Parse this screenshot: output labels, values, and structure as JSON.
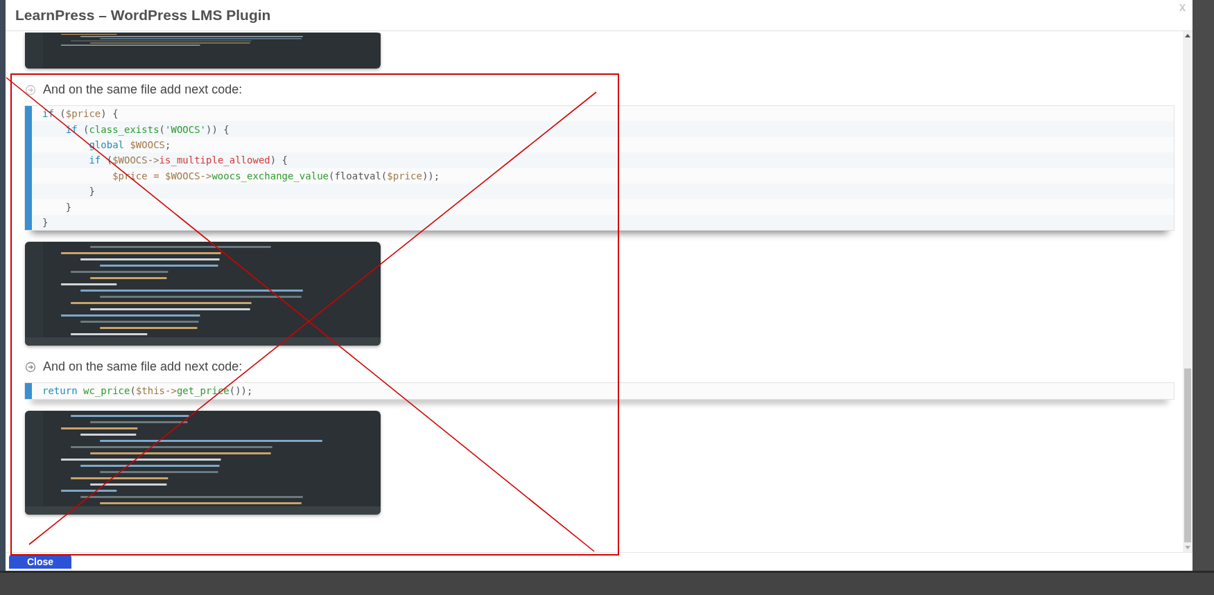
{
  "modal": {
    "title": "LearnPress – WordPress LMS Plugin",
    "close_glyph": "x"
  },
  "sections": [
    {
      "kind": "picture"
    },
    {
      "kind": "step",
      "text": "And on the same file add next code:",
      "faded": true
    },
    {
      "kind": "code",
      "lines": [
        [
          {
            "t": "if",
            "kind": "kw"
          },
          {
            "t": " (",
            "kind": "plain"
          },
          {
            "t": "$price",
            "kind": "var"
          },
          {
            "t": ") {",
            "kind": "plain"
          }
        ],
        [
          {
            "t": "    if",
            "kind": "kw"
          },
          {
            "t": " (",
            "kind": "plain"
          },
          {
            "t": "class_exists",
            "kind": "fn"
          },
          {
            "t": "(",
            "kind": "plain"
          },
          {
            "t": "'WOOCS'",
            "kind": "str"
          },
          {
            "t": ")) {",
            "kind": "plain"
          }
        ],
        [
          {
            "t": "        global",
            "kind": "kw"
          },
          {
            "t": " $WOOCS",
            "kind": "var"
          },
          {
            "t": ";",
            "kind": "plain"
          }
        ],
        [
          {
            "t": "        if",
            "kind": "kw"
          },
          {
            "t": " (",
            "kind": "plain"
          },
          {
            "t": "$WOOCS->",
            "kind": "var"
          },
          {
            "t": "is_multiple_allowed",
            "kind": "prop"
          },
          {
            "t": ") {",
            "kind": "plain"
          }
        ],
        [
          {
            "t": "            $price = $WOOCS->",
            "kind": "var"
          },
          {
            "t": "woocs_exchange_value",
            "kind": "fn"
          },
          {
            "t": "(floatval(",
            "kind": "plain"
          },
          {
            "t": "$price",
            "kind": "var"
          },
          {
            "t": "));",
            "kind": "plain"
          }
        ],
        [
          {
            "t": "        }",
            "kind": "plain"
          }
        ],
        [
          {
            "t": "    }",
            "kind": "plain"
          }
        ],
        [
          {
            "t": "}",
            "kind": "plain"
          }
        ]
      ]
    },
    {
      "kind": "picture"
    },
    {
      "kind": "step",
      "text": "And on the same file add next code:",
      "faded": false
    },
    {
      "kind": "code",
      "lines": [
        [
          {
            "t": "return",
            "kind": "kw"
          },
          {
            "t": " wc_price",
            "kind": "fn"
          },
          {
            "t": "(",
            "kind": "plain"
          },
          {
            "t": "$this->",
            "kind": "var"
          },
          {
            "t": "get_price",
            "kind": "fn"
          },
          {
            "t": "());",
            "kind": "plain"
          }
        ]
      ]
    },
    {
      "kind": "picture"
    }
  ],
  "buttons": [
    {
      "label": "Close"
    }
  ]
}
